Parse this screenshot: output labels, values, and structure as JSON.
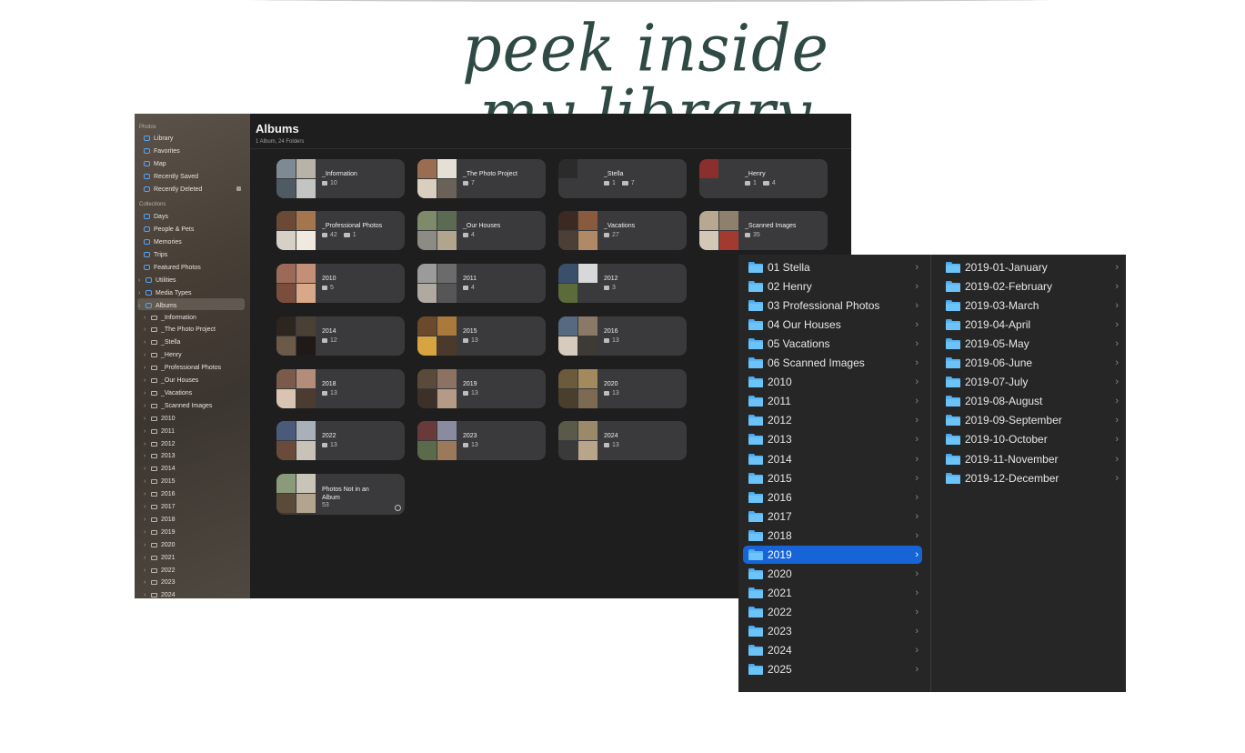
{
  "heading": "peek inside my library",
  "photos": {
    "sidebar": {
      "section_photos": "Photos",
      "section_collections": "Collections",
      "top_items": [
        {
          "label": "Library",
          "icon": "library-icon"
        },
        {
          "label": "Favorites",
          "icon": "heart-icon"
        },
        {
          "label": "Map",
          "icon": "map-icon"
        },
        {
          "label": "Recently Saved",
          "icon": "download-icon"
        },
        {
          "label": "Recently Deleted",
          "icon": "trash-icon"
        }
      ],
      "collection_items": [
        {
          "label": "Days",
          "icon": "clock-icon"
        },
        {
          "label": "People & Pets",
          "icon": "person-icon"
        },
        {
          "label": "Memories",
          "icon": "memories-icon"
        },
        {
          "label": "Trips",
          "icon": "trips-icon"
        },
        {
          "label": "Featured Photos",
          "icon": "featured-icon"
        },
        {
          "label": "Utilities",
          "icon": "utilities-icon"
        },
        {
          "label": "Media Types",
          "icon": "media-icon"
        },
        {
          "label": "Albums",
          "icon": "albums-icon"
        }
      ],
      "album_folders": [
        "_Information",
        "_The Photo Project",
        "_Stella",
        "_Henry",
        "_Professional Photos",
        "_Our Houses",
        "_Vacations",
        "_Scanned Images",
        "2010",
        "2011",
        "2012",
        "2013",
        "2014",
        "2015",
        "2016",
        "2017",
        "2018",
        "2019",
        "2020",
        "2021",
        "2022",
        "2023",
        "2024"
      ]
    },
    "title": "Albums",
    "subtitle": "1 Album, 24 Folders",
    "cards": [
      {
        "title": "_Information",
        "count": "10",
        "folders": ""
      },
      {
        "title": "_The Photo Project",
        "count": "7",
        "folders": ""
      },
      {
        "title": "_Stella",
        "count": "1",
        "folders": "7"
      },
      {
        "title": "_Henry",
        "count": "1",
        "folders": "4"
      },
      {
        "title": "_Professional Photos",
        "count": "42",
        "folders": "1"
      },
      {
        "title": "_Our Houses",
        "count": "4",
        "folders": ""
      },
      {
        "title": "_Vacations",
        "count": "27",
        "folders": ""
      },
      {
        "title": "_Scanned Images",
        "count": "35",
        "folders": ""
      },
      {
        "title": "2010",
        "count": "5",
        "folders": ""
      },
      {
        "title": "2011",
        "count": "4",
        "folders": ""
      },
      {
        "title": "2012",
        "count": "3",
        "folders": ""
      },
      {
        "title": "2014",
        "count": "12",
        "folders": ""
      },
      {
        "title": "2015",
        "count": "13",
        "folders": ""
      },
      {
        "title": "2016",
        "count": "13",
        "folders": ""
      },
      {
        "title": "2018",
        "count": "13",
        "folders": ""
      },
      {
        "title": "2019",
        "count": "13",
        "folders": ""
      },
      {
        "title": "2020",
        "count": "13",
        "folders": ""
      },
      {
        "title": "2022",
        "count": "13",
        "folders": ""
      },
      {
        "title": "2023",
        "count": "13",
        "folders": ""
      },
      {
        "title": "2024",
        "count": "13",
        "folders": ""
      }
    ],
    "not_in_album": {
      "title": "Photos Not in an Album",
      "count": "53"
    }
  },
  "finder": {
    "column1": [
      "01 Stella",
      "02 Henry",
      "03 Professional Photos",
      "04 Our Houses",
      "05 Vacations",
      "06 Scanned Images",
      "2010",
      "2011",
      "2012",
      "2013",
      "2014",
      "2015",
      "2016",
      "2017",
      "2018",
      "2019",
      "2020",
      "2021",
      "2022",
      "2023",
      "2024",
      "2025"
    ],
    "selected": "2019",
    "column2": [
      "2019-01-January",
      "2019-02-February",
      "2019-03-March",
      "2019-04-April",
      "2019-05-May",
      "2019-06-June",
      "2019-07-July",
      "2019-08-August",
      "2019-09-September",
      "2019-10-October",
      "2019-11-November",
      "2019-12-December"
    ]
  }
}
